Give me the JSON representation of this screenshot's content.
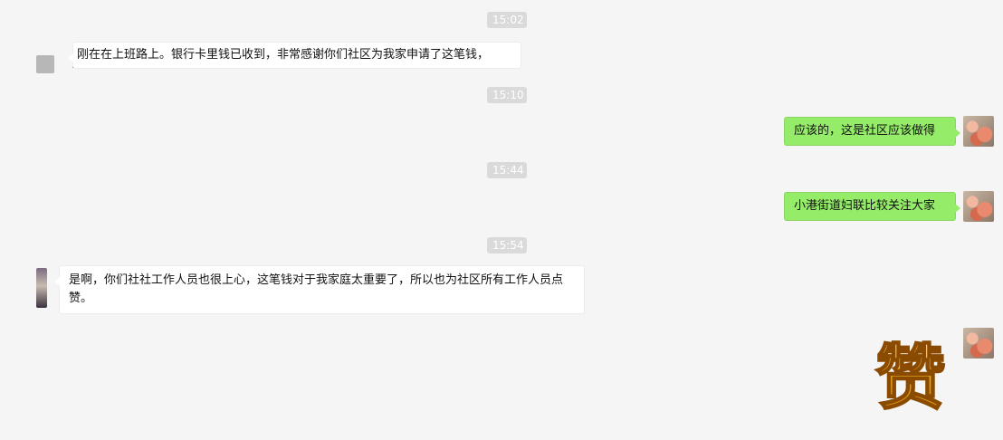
{
  "times": [
    "15:02",
    "15:10",
    "15:44",
    "15:54"
  ],
  "messages": [
    {
      "side": "in",
      "text": "刚在在上班路上。银行卡里钱已收到，非常感谢你们社区为我家申请了这笔钱，"
    },
    {
      "side": "out",
      "text": "应该的，这是社区应该做得"
    },
    {
      "side": "out",
      "text": "小港街道妇联比较关注大家"
    },
    {
      "side": "in",
      "text": "是啊，你们社社工作人员也很上心，这笔钱对于我家庭太重要了，所以也为社区所有工作人员点赞。"
    }
  ],
  "sticker": {
    "text": "赞",
    "color": "#f2b51f"
  },
  "colors": {
    "background": "#f5f5f5",
    "outgoing": "#95ec69",
    "incoming": "#ffffff",
    "time_bg": "#dadada"
  }
}
